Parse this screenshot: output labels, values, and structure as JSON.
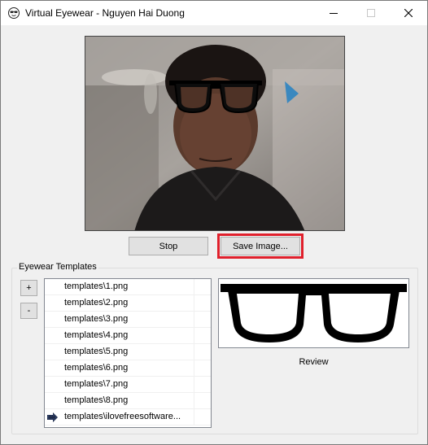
{
  "window": {
    "title": "Virtual Eyewear - Nguyen Hai Duong"
  },
  "controls": {
    "stop_label": "Stop",
    "save_label": "Save Image..."
  },
  "templates": {
    "group_label": "Eyewear Templates",
    "add_label": "+",
    "remove_label": "-",
    "items": [
      "templates\\1.png",
      "templates\\2.png",
      "templates\\3.png",
      "templates\\4.png",
      "templates\\5.png",
      "templates\\6.png",
      "templates\\7.png",
      "templates\\8.png",
      "templates\\ilovefreesoftware..."
    ],
    "selected_index": 8
  },
  "review": {
    "label": "Review"
  },
  "colors": {
    "highlight": "#e0202c",
    "window_bg": "#f0f0f0",
    "button_bg": "#e1e1e1"
  }
}
